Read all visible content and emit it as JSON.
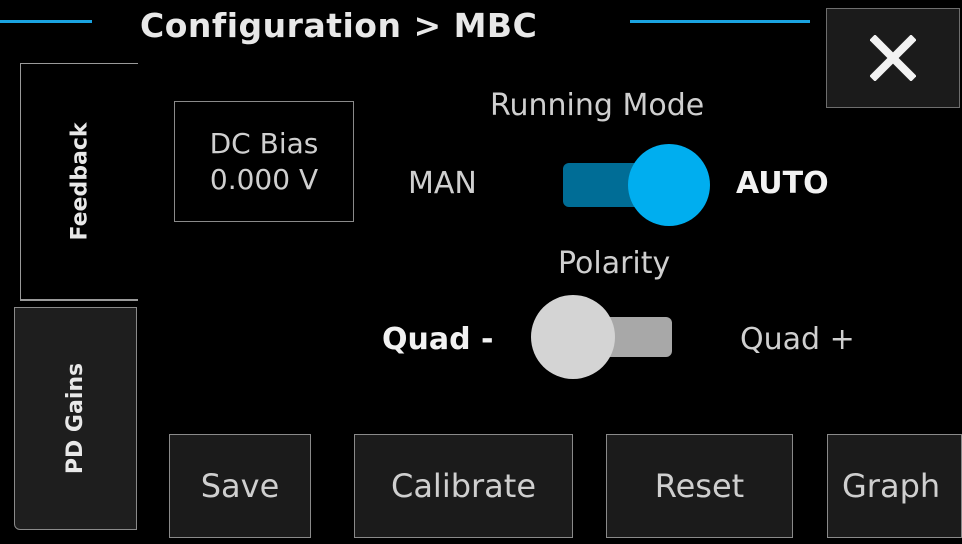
{
  "header": {
    "title": "Configuration > MBC",
    "accent_color": "#1aa3e0",
    "close_icon": "close-icon"
  },
  "tabs": [
    {
      "label": "Feedback",
      "active": true
    },
    {
      "label": "PD Gains",
      "active": false
    }
  ],
  "dc_bias": {
    "label": "DC Bias",
    "value": "0.000 V"
  },
  "running_mode": {
    "label": "Running Mode",
    "off_label": "MAN",
    "on_label": "AUTO",
    "state": "AUTO",
    "color_on": "#00aeef"
  },
  "polarity": {
    "label": "Polarity",
    "left_label": "Quad -",
    "right_label": "Quad +",
    "state": "Quad -"
  },
  "buttons": {
    "save": "Save",
    "calibrate": "Calibrate",
    "reset": "Reset",
    "graph": "Graph"
  }
}
